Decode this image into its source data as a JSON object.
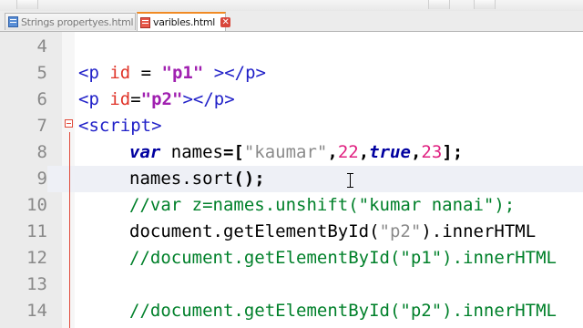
{
  "tabs": [
    {
      "label": "Strings propertyes.html",
      "active": false,
      "icon": "file-icon-blue"
    },
    {
      "label": "varibles.html",
      "active": true,
      "icon": "file-icon-red"
    }
  ],
  "colors": {
    "tag": "#2020c8",
    "attribute": "#e0352a",
    "attr_value": "#a020b0",
    "keyword": "#0000a0",
    "js_string": "#8a8a8a",
    "number": "#e02080",
    "comment": "#00802a",
    "fold_marker": "#e04a3a",
    "active_tab_accent": "#f08a24"
  },
  "editor": {
    "current_line": "9",
    "lines": [
      {
        "num": "4"
      },
      {
        "num": "5",
        "t1": "<p ",
        "t2": "id",
        "t3": " = ",
        "t4": "\"p1\"",
        "t5": " ></p>"
      },
      {
        "num": "6",
        "t1": "<p ",
        "t2": "id",
        "t3": "=",
        "t4": "\"p2\"",
        "t5": "></p>"
      },
      {
        "num": "7",
        "t1": "<script>"
      },
      {
        "num": "8",
        "t1": "var",
        "t2": " names",
        "t3": "=[",
        "t4": "\"kaumar\"",
        "t5": ",",
        "t6": "22",
        "t7": ",",
        "t8": "true",
        "t9": ",",
        "t10": "23",
        "t11": "];"
      },
      {
        "num": "9",
        "t1": "names.sort",
        "t2": "();"
      },
      {
        "num": "10",
        "t1": "//var z=names.unshift(\"kumar nanai\");"
      },
      {
        "num": "11",
        "t1": "document.getElementById(",
        "t2": "\"p2\"",
        "t3": ").innerHTML"
      },
      {
        "num": "12",
        "t1": "//document.getElementById(\"p1\").innerHTML"
      },
      {
        "num": "13"
      },
      {
        "num": "14",
        "t1": "//document.getElementById(\"p2\").innerHTML"
      }
    ]
  }
}
